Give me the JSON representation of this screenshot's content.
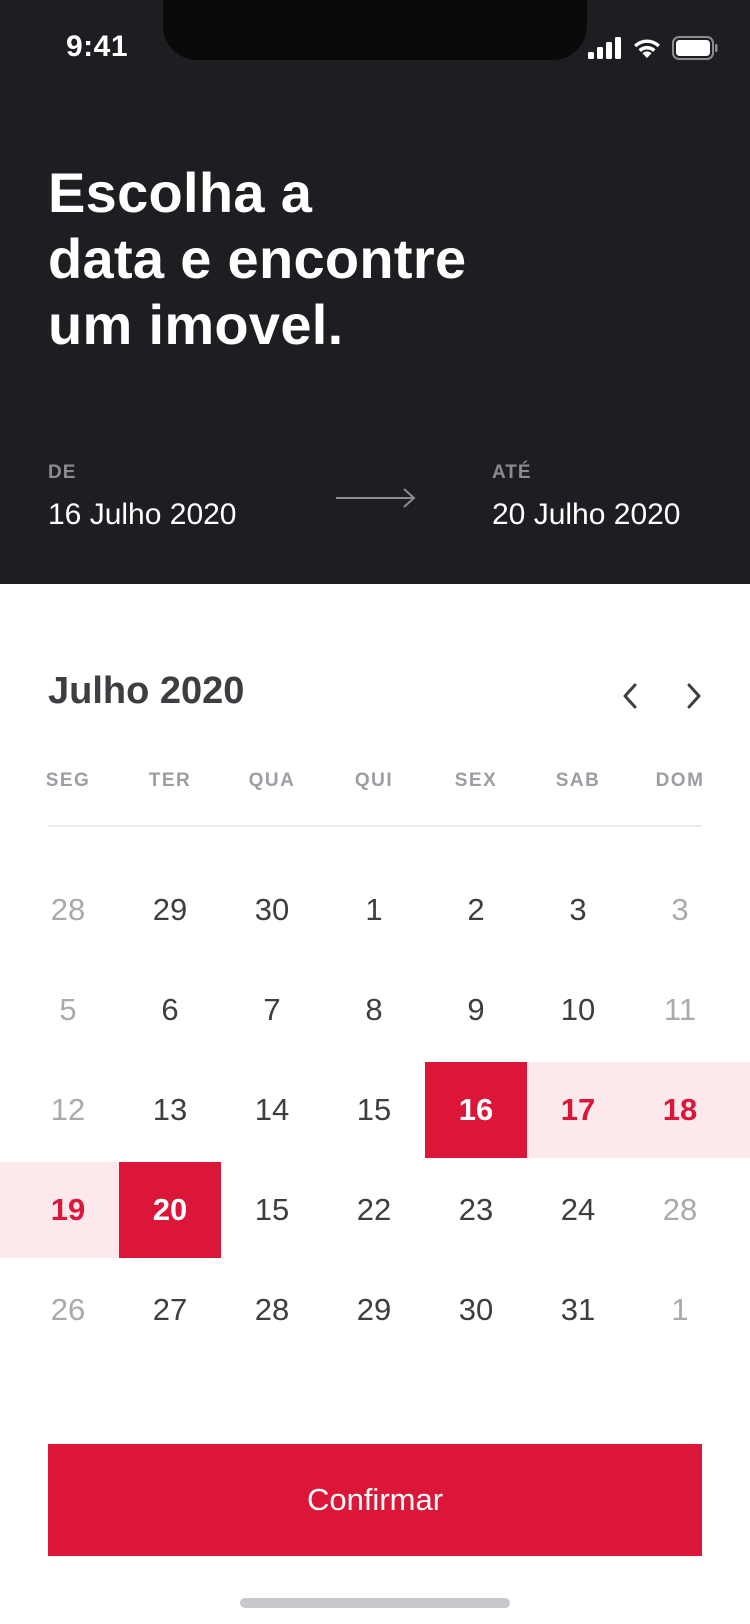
{
  "status_bar": {
    "time": "9:41"
  },
  "header": {
    "headline_lines": [
      "Escolha a",
      "data e encontre",
      "um imovel."
    ],
    "from_label": "DE",
    "from_date": "16 Julho 2020",
    "to_label": "ATÉ",
    "to_date": "20 Julho 2020"
  },
  "calendar": {
    "month_title": "Julho 2020",
    "weekdays": [
      "SEG",
      "TER",
      "QUA",
      "QUI",
      "SEX",
      "SAB",
      "DOM"
    ],
    "rows": [
      [
        {
          "d": "28",
          "s": "muted"
        },
        {
          "d": "29",
          "s": ""
        },
        {
          "d": "30",
          "s": ""
        },
        {
          "d": "1",
          "s": ""
        },
        {
          "d": "2",
          "s": ""
        },
        {
          "d": "3",
          "s": ""
        },
        {
          "d": "3",
          "s": "muted"
        }
      ],
      [
        {
          "d": "5",
          "s": "muted"
        },
        {
          "d": "6",
          "s": ""
        },
        {
          "d": "7",
          "s": ""
        },
        {
          "d": "8",
          "s": ""
        },
        {
          "d": "9",
          "s": ""
        },
        {
          "d": "10",
          "s": ""
        },
        {
          "d": "11",
          "s": "muted"
        }
      ],
      [
        {
          "d": "12",
          "s": "muted"
        },
        {
          "d": "13",
          "s": ""
        },
        {
          "d": "14",
          "s": ""
        },
        {
          "d": "15",
          "s": ""
        },
        {
          "d": "16",
          "s": "sel"
        },
        {
          "d": "17",
          "s": "range"
        },
        {
          "d": "18",
          "s": "range"
        }
      ],
      [
        {
          "d": "19",
          "s": "range"
        },
        {
          "d": "20",
          "s": "sel"
        },
        {
          "d": "15",
          "s": ""
        },
        {
          "d": "22",
          "s": ""
        },
        {
          "d": "23",
          "s": ""
        },
        {
          "d": "24",
          "s": ""
        },
        {
          "d": "28",
          "s": "muted"
        }
      ],
      [
        {
          "d": "26",
          "s": "muted"
        },
        {
          "d": "27",
          "s": ""
        },
        {
          "d": "28",
          "s": ""
        },
        {
          "d": "29",
          "s": ""
        },
        {
          "d": "30",
          "s": ""
        },
        {
          "d": "31",
          "s": ""
        },
        {
          "d": "1",
          "s": "muted"
        }
      ]
    ]
  },
  "colors": {
    "accent": "#dc1638",
    "range_bg": "#fde9ec",
    "header_bg": "#1e1e22"
  },
  "icons": {
    "prev": "chevron-left-icon",
    "next": "chevron-right-icon",
    "arrow": "arrow-right-icon"
  },
  "confirm_label": "Confirmar"
}
